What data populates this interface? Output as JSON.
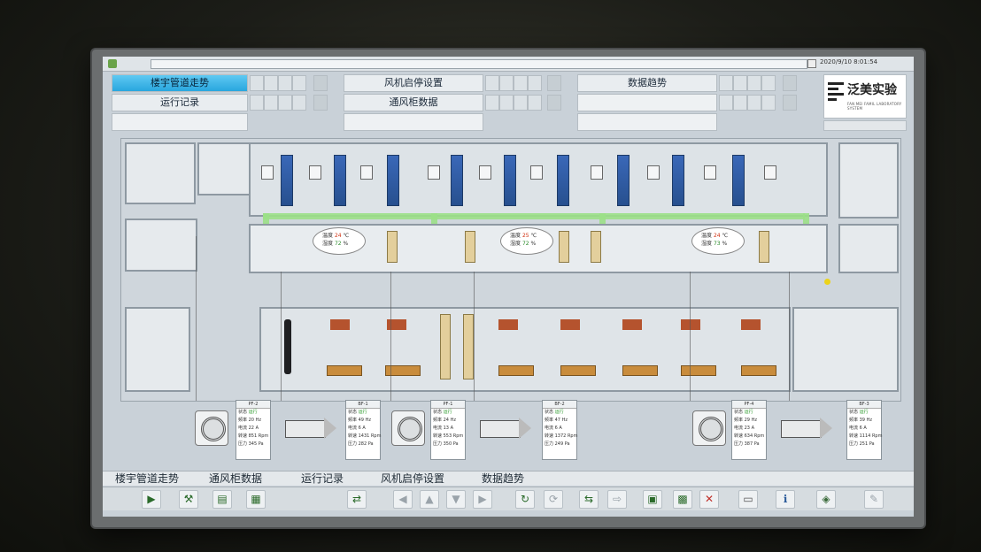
{
  "titlebar": {
    "clock": "2020/9/10 8:01:54"
  },
  "nav": {
    "row1": [
      "楼宇管道走势",
      "风机启停设置",
      "数据趋势"
    ],
    "row2": [
      "运行记录",
      "通风柜数据",
      ""
    ],
    "active": "楼宇管道走势"
  },
  "brand": {
    "name": "泛美实验",
    "sub": "FAN MEI  FAMIL LABORATORY SYSTEM"
  },
  "sensors": [
    {
      "temp_label": "温度",
      "temp": "24",
      "temp_unit": "℃",
      "hum_label": "湿度",
      "hum": "72",
      "hum_unit": "%"
    },
    {
      "temp_label": "温度",
      "temp": "25",
      "temp_unit": "℃",
      "hum_label": "湿度",
      "hum": "72",
      "hum_unit": "%"
    },
    {
      "temp_label": "温度",
      "temp": "24",
      "temp_unit": "℃",
      "hum_label": "湿度",
      "hum": "73",
      "hum_unit": "%"
    }
  ],
  "panels": [
    {
      "id": "PF-2",
      "status": "运行",
      "freq": "20",
      "current": "22",
      "speed": "851",
      "pressure": "345"
    },
    {
      "id": "BF-1",
      "status": "运行",
      "freq": "49",
      "current": "6",
      "speed": "1431",
      "pressure": "282"
    },
    {
      "id": "PF-1",
      "status": "运行",
      "freq": "24",
      "current": "13",
      "speed": "553",
      "pressure": "350"
    },
    {
      "id": "BF-2",
      "status": "运行",
      "freq": "47",
      "current": "6",
      "speed": "1372",
      "pressure": "249"
    },
    {
      "id": "PF-4",
      "status": "运行",
      "freq": "29",
      "current": "23",
      "speed": "634",
      "pressure": "387"
    },
    {
      "id": "BF-3",
      "status": "运行",
      "freq": "39",
      "current": "6",
      "speed": "1114",
      "pressure": "251"
    }
  ],
  "panel_labels": {
    "status": "状态",
    "freq": "频率",
    "current": "电流",
    "speed": "转速",
    "pressure": "压力",
    "freq_unit": "Hz",
    "current_unit": "A",
    "speed_unit": "Rpm",
    "pressure_unit": "Pa"
  },
  "tabs": [
    "楼宇管道走势",
    "通风柜数据",
    "运行记录",
    "风机启停设置",
    "数据趋势"
  ],
  "toolbar": [
    "play-icon",
    "tools-icon",
    "folder-icon",
    "page-icon",
    "network-icon",
    "arrow-left-icon",
    "arrow-up-icon",
    "arrow-down-icon",
    "arrow-right-icon",
    "refresh-icon",
    "sync-icon",
    "exchange-icon",
    "forward-icon",
    "open-file-icon",
    "save-icon",
    "delete-icon",
    "printer-icon",
    "info-icon",
    "speaker-icon",
    "pen-icon"
  ]
}
